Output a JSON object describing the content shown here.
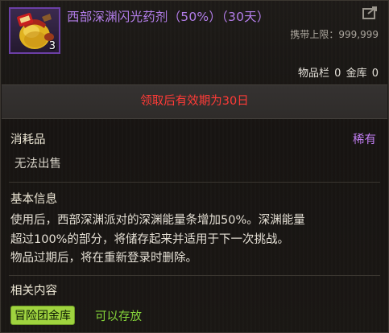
{
  "item": {
    "name": "西部深渊闪光药剂（50%）（30天）",
    "stack_count": "3",
    "icon": "yellow-potion-pouch-icon",
    "carry_limit_label": "携带上限：",
    "carry_limit_value": "999,999",
    "inventory_counts": "物品栏 0 金库 0"
  },
  "validity_notice": "领取后有效期为30日",
  "category": "消耗品",
  "rarity": "稀有",
  "trade_status": "无法出售",
  "basic_info": {
    "title": "基本信息",
    "lines": [
      "使用后，西部深渊派对的深渊能量条增加50%。深渊能量",
      "超过100%的部分，将储存起来并适用于下一次挑战。",
      "物品过期后，将在重新登录时删除。"
    ]
  },
  "related": {
    "title": "相关内容",
    "badge": "冒险团金库",
    "note": "可以存放"
  },
  "colors": {
    "item_name": "#b27de8",
    "rarity": "#c27ef4",
    "validity": "#ff3b37",
    "badge_bg": "#9fd33f",
    "storage_note": "#86d63a"
  }
}
